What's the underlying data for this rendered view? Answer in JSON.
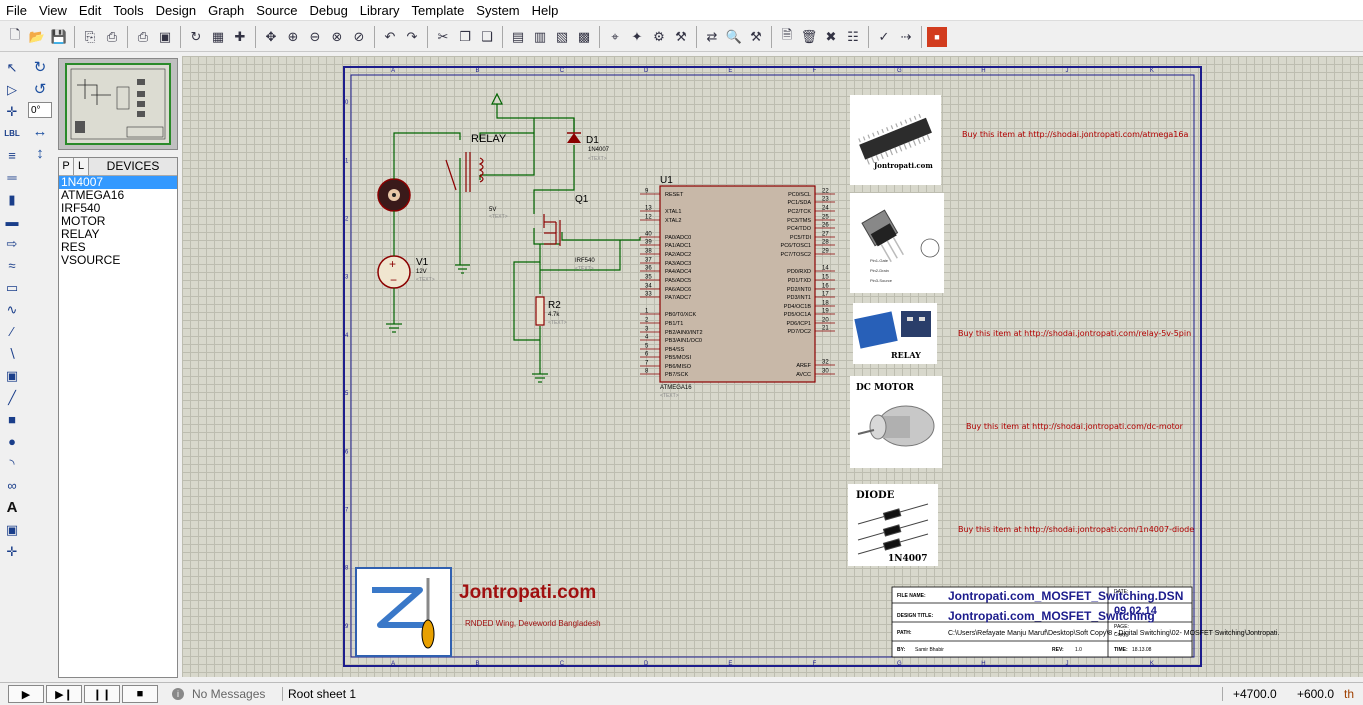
{
  "menu": [
    "File",
    "View",
    "Edit",
    "Tools",
    "Design",
    "Graph",
    "Source",
    "Debug",
    "Library",
    "Template",
    "System",
    "Help"
  ],
  "rotation": {
    "angle": "0°"
  },
  "device_panel": {
    "pick_label": "P",
    "lib_label": "L",
    "title": "DEVICES",
    "items": [
      "1N4007",
      "ATMEGA16",
      "IRF540",
      "MOTOR",
      "RELAY",
      "RES",
      "VSOURCE"
    ],
    "selected_index": 0
  },
  "schematic": {
    "col_labels": [
      "A",
      "B",
      "C",
      "D",
      "E",
      "F",
      "G",
      "H",
      "J",
      "K"
    ],
    "row_labels": [
      "0",
      "1",
      "2",
      "3",
      "4",
      "5",
      "6",
      "7",
      "8",
      "9"
    ],
    "relay_label": "RELAY",
    "d1": {
      "ref": "D1",
      "value": "1N4007",
      "text": "<TEXT>"
    },
    "q1": {
      "ref": "Q1",
      "value": "IRF540",
      "text": "<TEXT>"
    },
    "v1": {
      "ref": "V1",
      "value": "12V",
      "text": "<TEXT>"
    },
    "r2": {
      "ref": "R2",
      "value": "4.7k",
      "text": "<TEXT>"
    },
    "v5": {
      "value": "5V",
      "text": "<TEXT>"
    },
    "u1": {
      "ref": "U1",
      "part": "ATMEGA16",
      "text": "<TEXT>",
      "left_pins": [
        {
          "num": "9",
          "name": "RESET"
        },
        {
          "num": "13",
          "name": "XTAL1"
        },
        {
          "num": "12",
          "name": "XTAL2"
        },
        {
          "num": "40",
          "name": "PA0/ADC0"
        },
        {
          "num": "39",
          "name": "PA1/ADC1"
        },
        {
          "num": "38",
          "name": "PA2/ADC2"
        },
        {
          "num": "37",
          "name": "PA3/ADC3"
        },
        {
          "num": "36",
          "name": "PA4/ADC4"
        },
        {
          "num": "35",
          "name": "PA5/ADC5"
        },
        {
          "num": "34",
          "name": "PA6/ADC6"
        },
        {
          "num": "33",
          "name": "PA7/ADC7"
        },
        {
          "num": "1",
          "name": "PB0/T0/XCK"
        },
        {
          "num": "2",
          "name": "PB1/T1"
        },
        {
          "num": "3",
          "name": "PB2/AIN0/INT2"
        },
        {
          "num": "4",
          "name": "PB3/AIN1/OC0"
        },
        {
          "num": "5",
          "name": "PB4/SS"
        },
        {
          "num": "6",
          "name": "PB5/MOSI"
        },
        {
          "num": "7",
          "name": "PB6/MISO"
        },
        {
          "num": "8",
          "name": "PB7/SCK"
        }
      ],
      "right_pins": [
        {
          "num": "22",
          "name": "PC0/SCL"
        },
        {
          "num": "23",
          "name": "PC1/SDA"
        },
        {
          "num": "24",
          "name": "PC2/TCK"
        },
        {
          "num": "25",
          "name": "PC3/TMS"
        },
        {
          "num": "26",
          "name": "PC4/TDO"
        },
        {
          "num": "27",
          "name": "PC5/TDI"
        },
        {
          "num": "28",
          "name": "PC6/TOSC1"
        },
        {
          "num": "29",
          "name": "PC7/TOSC2"
        },
        {
          "num": "14",
          "name": "PD0/RXD"
        },
        {
          "num": "15",
          "name": "PD1/TXD"
        },
        {
          "num": "16",
          "name": "PD2/INT0"
        },
        {
          "num": "17",
          "name": "PD3/INT1"
        },
        {
          "num": "18",
          "name": "PD4/OC1B"
        },
        {
          "num": "19",
          "name": "PD5/OC1A"
        },
        {
          "num": "20",
          "name": "PD6/ICP1"
        },
        {
          "num": "21",
          "name": "PD7/OC2"
        },
        {
          "num": "32",
          "name": "AREF"
        },
        {
          "num": "30",
          "name": "AVCC"
        }
      ]
    }
  },
  "products": [
    {
      "caption": "Jontropati.com",
      "link": "Buy this item at http://shodai.jontropati.com/atmega16a"
    },
    {
      "caption": "",
      "link": "",
      "pin_labels": [
        "Pin1-Gate",
        "Pin2-Drain",
        "Pin3-Source"
      ]
    },
    {
      "caption": "RELAY",
      "link": "Buy this item at http://shodai.jontropati.com/relay-5v-5pin"
    },
    {
      "caption": "DC MOTOR",
      "link": "Buy this item at http://shodai.jontropati.com/dc-motor"
    },
    {
      "caption": "DIODE",
      "caption2": "1N4007",
      "link": "Buy this item at http://shodai.jontropati.com/1n4007-diode"
    }
  ],
  "branding": {
    "site": "Jontropati.com",
    "tagline": "RNDED Wing, Deveworld Bangladesh"
  },
  "title_block": {
    "file_name_label": "FILE NAME:",
    "file_name": "Jontropati.com_MOSFET_Switching.DSN",
    "date_label": "DATE:",
    "date": "09.02.14",
    "design_title_label": "DESIGN TITLE:",
    "design_title": "Jontropati.com_MOSFET_Switching",
    "page_label": "PAGE:",
    "path_label": "PATH:",
    "path": "C:\\Users\\Refayate Manju Maruf\\Desktop\\Soft Copy\\8 - Digital Switching\\02- MOSFET Switching\\Jontropati.",
    "copy_label": "Copy:",
    "by_label": "BY:",
    "by": "Samir Bhabir",
    "rev_label": "REV:",
    "rev": "1.0",
    "time_label": "TIME:",
    "time": "18.13.08"
  },
  "status": {
    "messages": "No Messages",
    "sheet": "Root sheet 1",
    "x": "+4700.0",
    "y": "+600.0",
    "unit": "th"
  },
  "colors": {
    "sheet_border": "#1c1c8c",
    "wire": "#006400",
    "component": "#8b0000",
    "grid_bg": "#d8d8cc"
  }
}
